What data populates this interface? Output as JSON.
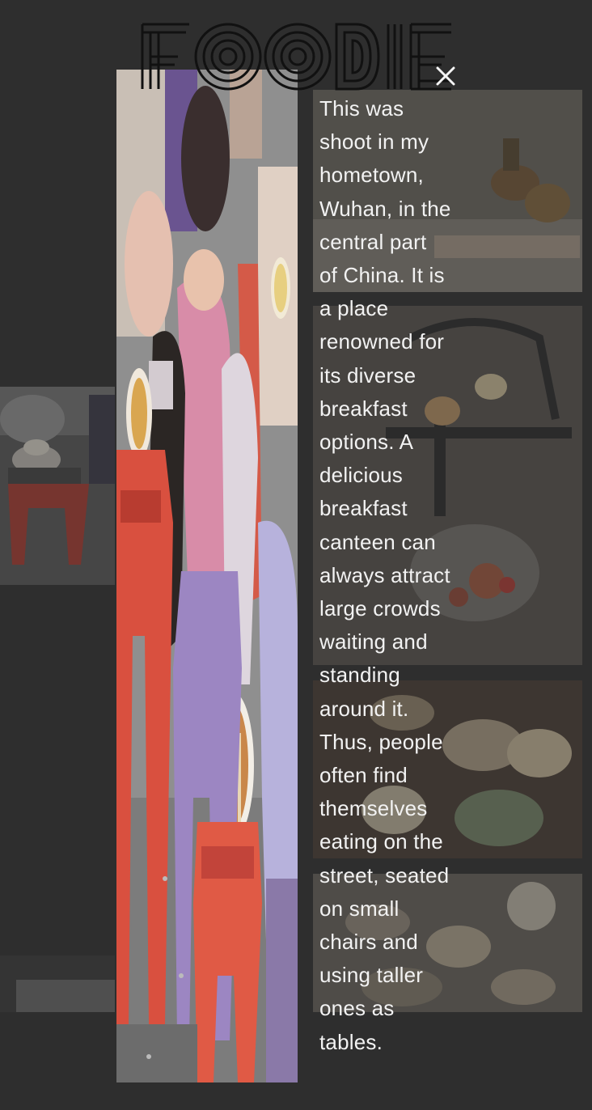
{
  "header": {
    "logo_text": "FOODIE",
    "close_icon": "close-icon"
  },
  "caption": {
    "text": "This was\nshoot in my\nhometown,\nWuhan, in the\ncentral part\nof China. It is\na place\nrenowned for\nits diverse\nbreakfast\noptions. A\ndelicious\nbreakfast\ncanteen can\nalways attract\nlarge crowds\nwaiting and\nstanding\naround it.\nThus, people\noften find\nthemselves\neating on the\nstreet, seated\non small\nchairs and\nusing taller\nones as\ntables."
  },
  "colors": {
    "background": "#2e2e2e",
    "text": "#f2f2f2",
    "stool_red": "#d9503f",
    "stool_purple": "#9c86c2"
  }
}
